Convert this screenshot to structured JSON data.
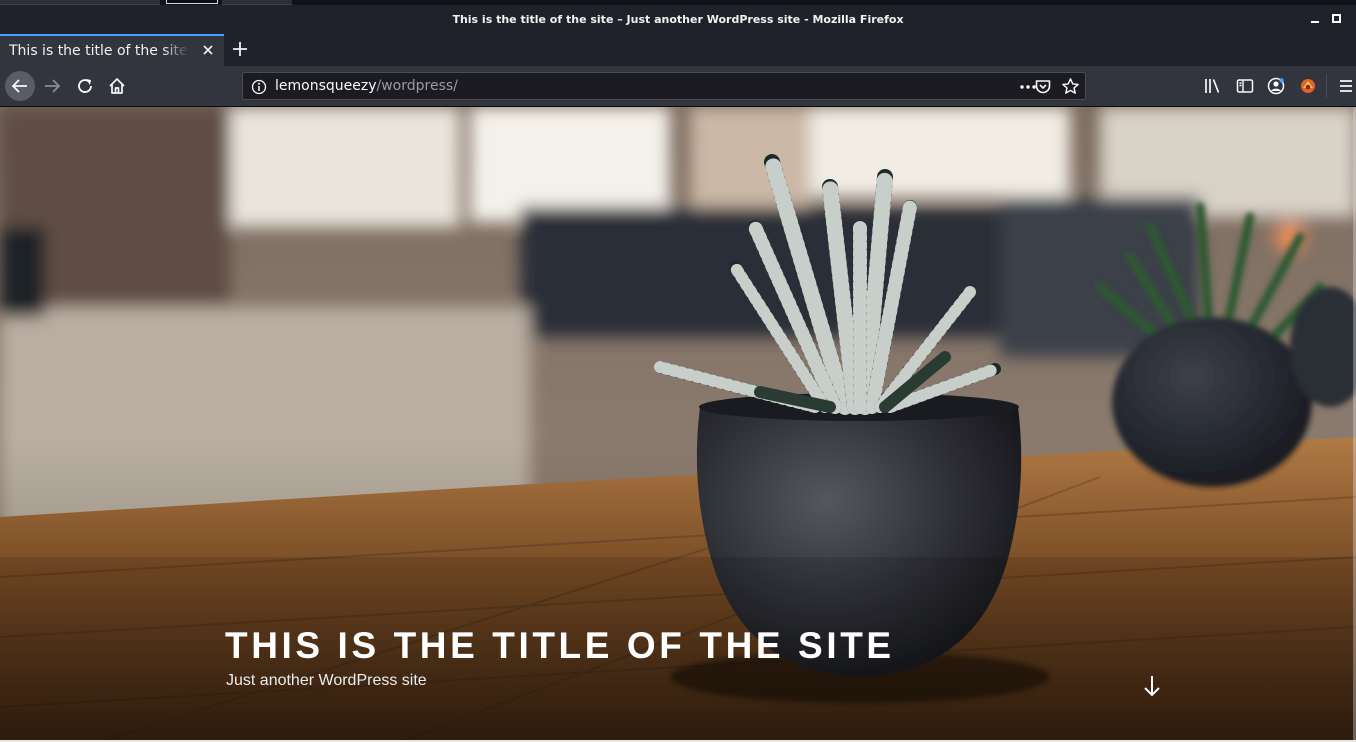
{
  "window": {
    "title": "This is the title of the site – Just another WordPress site - Mozilla Firefox"
  },
  "tabs": [
    {
      "title": "This is the title of the site – Just another WordPress site",
      "active": true
    }
  ],
  "urlbar": {
    "host": "lemonsqueezy",
    "path": "/wordpress/"
  },
  "icons": {
    "back": "back-arrow-icon",
    "forward": "forward-arrow-icon",
    "reload": "reload-icon",
    "home": "home-icon",
    "info": "info-icon",
    "page_actions": "ellipsis-icon",
    "pocket": "pocket-icon",
    "bookmark": "star-icon",
    "library": "library-icon",
    "sidebar": "sidebar-icon",
    "account": "account-icon",
    "extension": "extension-icon",
    "menu": "hamburger-menu-icon",
    "scroll": "arrow-down-icon"
  },
  "site": {
    "title": "This is the title of the site",
    "description": "Just another WordPress site"
  },
  "colors": {
    "accent": "#45a1ff",
    "toolbar": "#32353e",
    "titlebar": "#1f222b"
  }
}
